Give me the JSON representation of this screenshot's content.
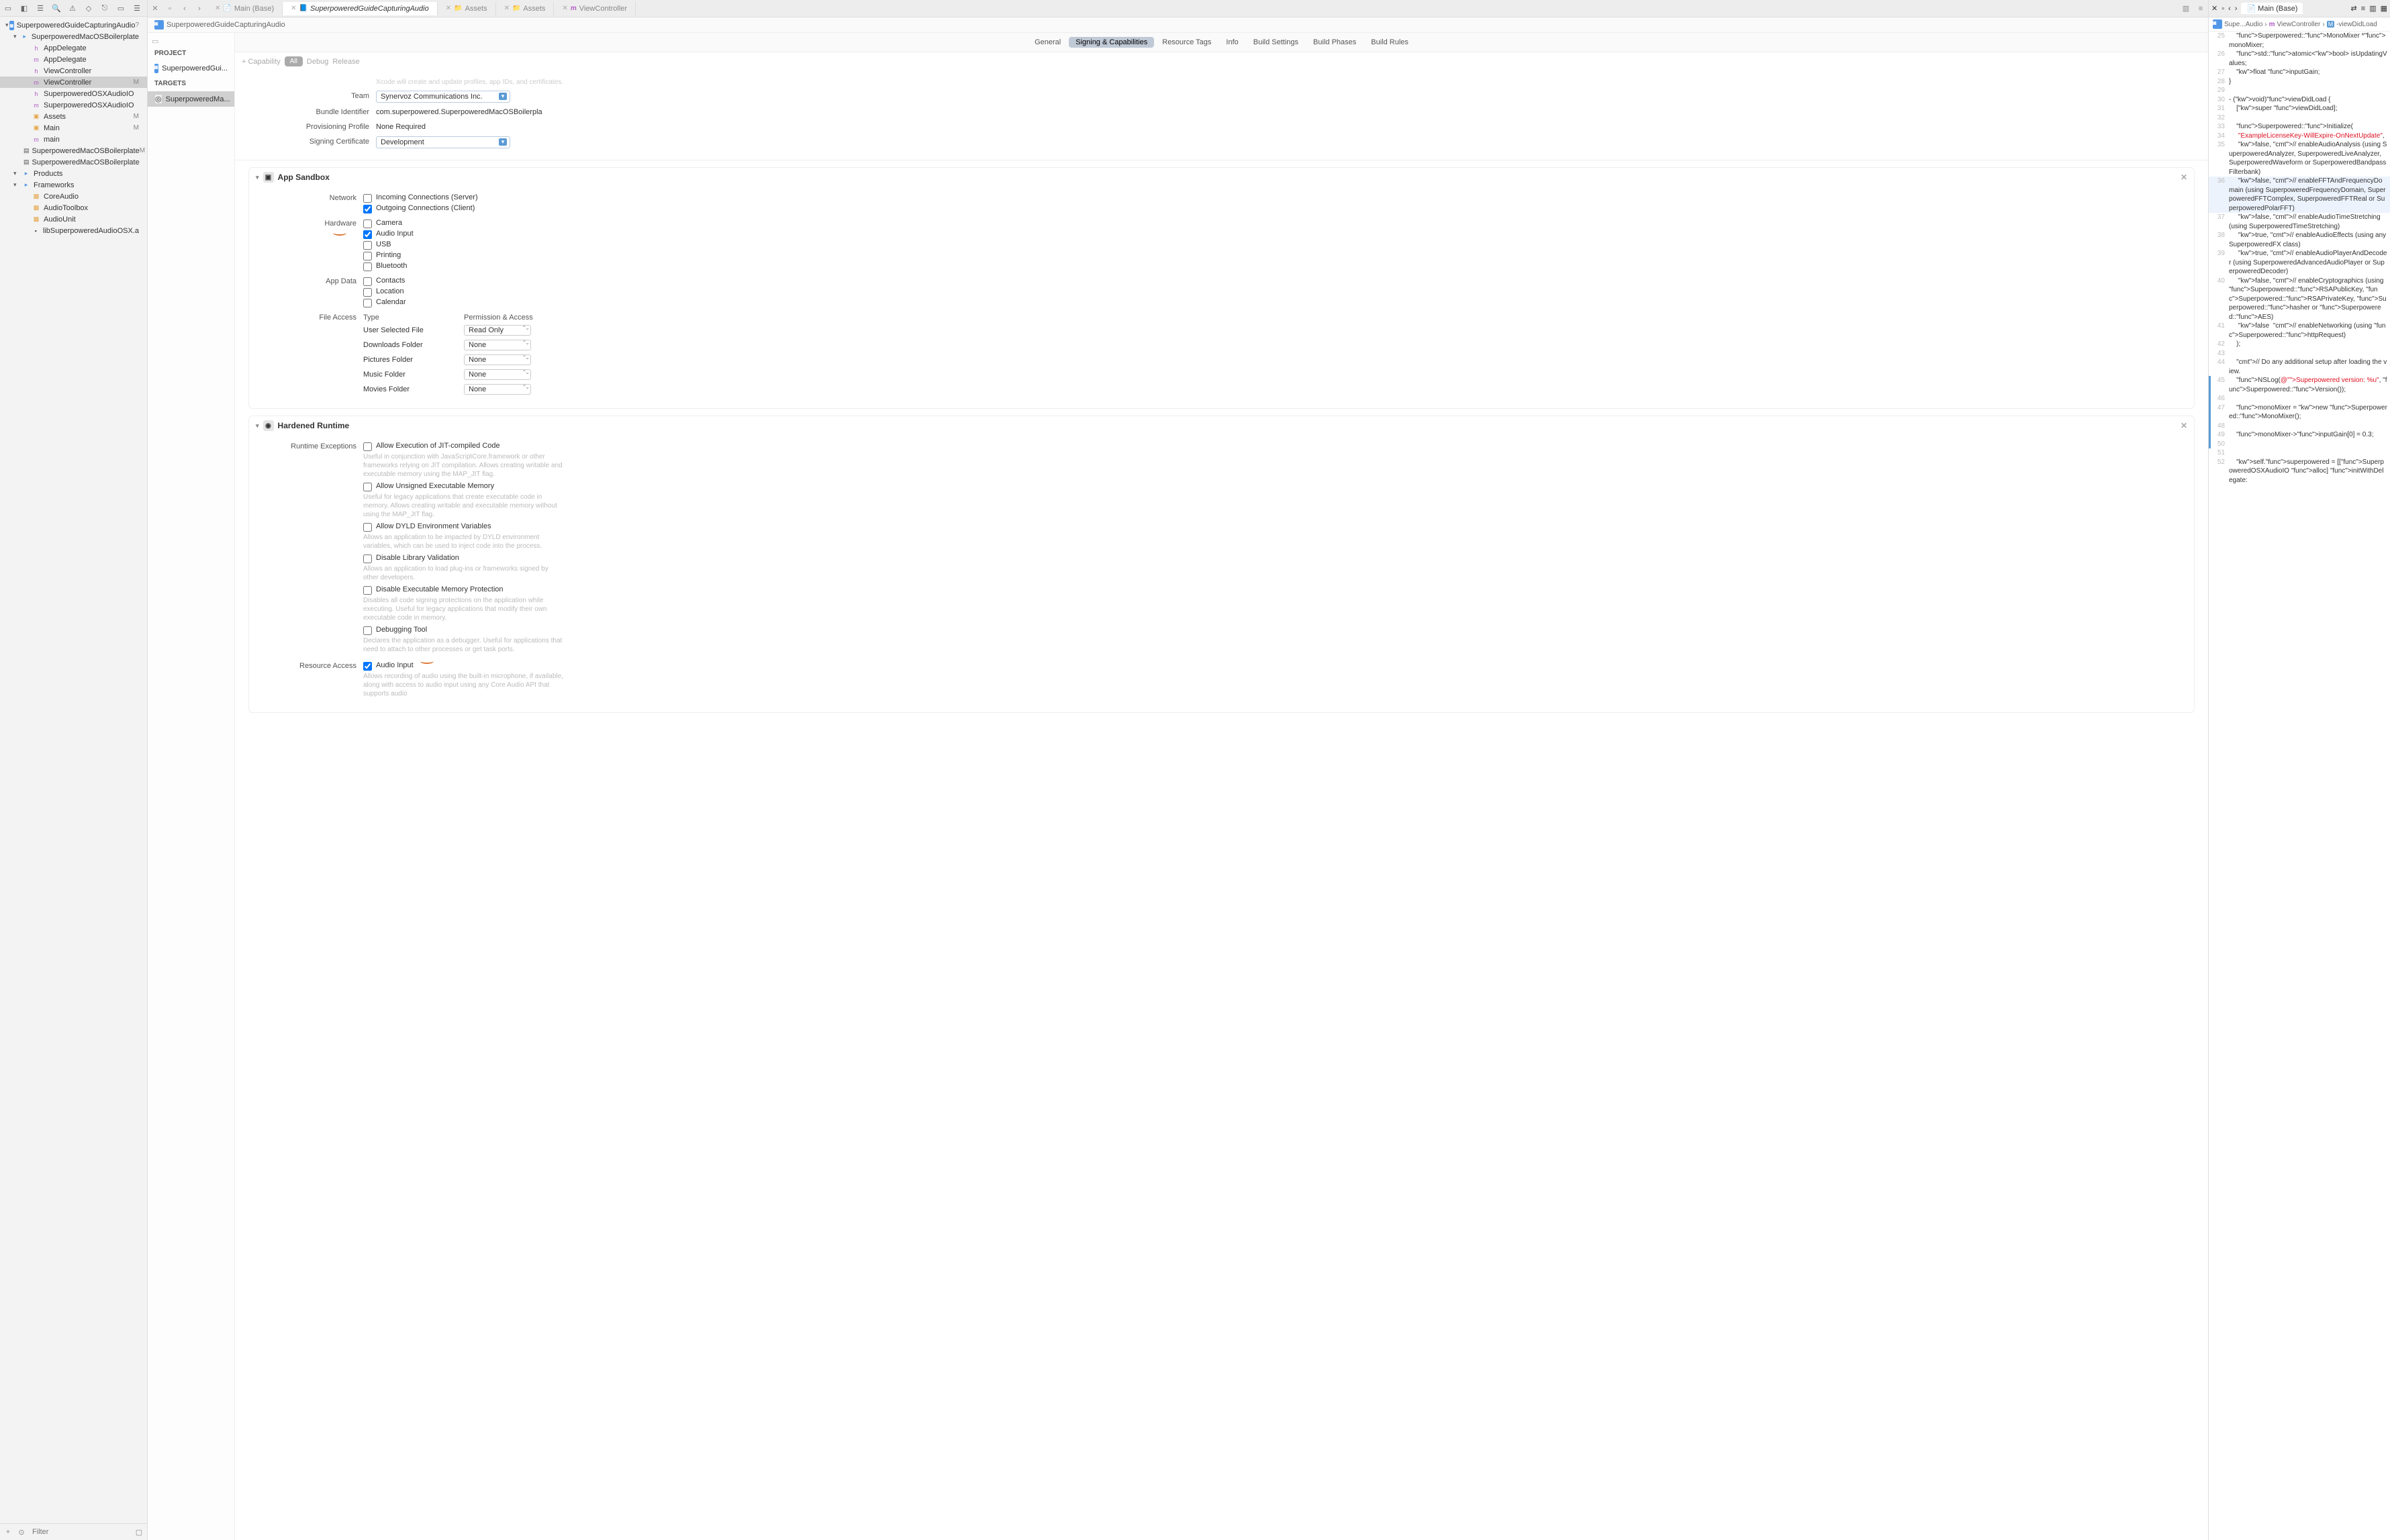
{
  "nav": {
    "root": "SuperpoweredGuideCapturingAudio",
    "rootBadge": "?",
    "items": [
      {
        "label": "SuperpoweredMacOSBoilerplate",
        "icon": "folder",
        "level": 1,
        "badge": ""
      },
      {
        "label": "AppDelegate",
        "icon": "h",
        "level": 2,
        "badge": ""
      },
      {
        "label": "AppDelegate",
        "icon": "m",
        "level": 2,
        "badge": ""
      },
      {
        "label": "ViewController",
        "icon": "h",
        "level": 2,
        "badge": ""
      },
      {
        "label": "ViewController",
        "icon": "m",
        "level": 2,
        "badge": "M",
        "selected": true
      },
      {
        "label": "SuperpoweredOSXAudioIO",
        "icon": "h",
        "level": 2,
        "badge": ""
      },
      {
        "label": "SuperpoweredOSXAudioIO",
        "icon": "m",
        "level": 2,
        "badge": ""
      },
      {
        "label": "Assets",
        "icon": "assets",
        "level": 2,
        "badge": "M"
      },
      {
        "label": "Main",
        "icon": "assets",
        "level": 2,
        "badge": "M"
      },
      {
        "label": "main",
        "icon": "m",
        "level": 2,
        "badge": ""
      },
      {
        "label": "SuperpoweredMacOSBoilerplate",
        "icon": "plist",
        "level": 2,
        "badge": "M"
      },
      {
        "label": "SuperpoweredMacOSBoilerplate",
        "icon": "plist",
        "level": 2,
        "badge": ""
      },
      {
        "label": "Products",
        "icon": "folder",
        "level": 1,
        "badge": ""
      },
      {
        "label": "CoreAudio",
        "icon": "fw",
        "level": 2,
        "badge": ""
      },
      {
        "label": "AudioToolbox",
        "icon": "fw",
        "level": 2,
        "badge": ""
      },
      {
        "label": "AudioUnit",
        "icon": "fw",
        "level": 2,
        "badge": ""
      },
      {
        "label": "libSuperpoweredAudioOSX.a",
        "icon": "lib",
        "level": 2,
        "badge": ""
      }
    ],
    "frameworksLabel": "Frameworks",
    "filterPlaceholder": "Filter"
  },
  "tabs": [
    {
      "label": "Main (Base)",
      "icon": "📄",
      "active": false
    },
    {
      "label": "SuperpoweredGuideCapturingAudio",
      "icon": "📘",
      "active": true,
      "italic": true
    },
    {
      "label": "Assets",
      "icon": "📁",
      "active": false
    },
    {
      "label": "Assets",
      "icon": "📁",
      "active": false
    },
    {
      "label": "ViewController",
      "icon": "m",
      "active": false
    }
  ],
  "breadcrumb": "SuperpoweredGuideCapturingAudio",
  "projectList": {
    "projectLabel": "PROJECT",
    "projectName": "SuperpoweredGui...",
    "targetsLabel": "TARGETS",
    "targetName": "SuperpoweredMa..."
  },
  "settingsTabs": [
    "General",
    "Signing & Capabilities",
    "Resource Tags",
    "Info",
    "Build Settings",
    "Build Phases",
    "Build Rules"
  ],
  "activeSettingsTab": "Signing & Capabilities",
  "capControls": {
    "capability": "+ Capability",
    "all": "All",
    "debug": "Debug",
    "release": "Release"
  },
  "signing": {
    "hint": "Xcode will create and update profiles, app IDs, and certificates.",
    "teamLabel": "Team",
    "teamValue": "Synervoz Communications Inc.",
    "bundleLabel": "Bundle Identifier",
    "bundleValue": "com.superpowered.SuperpoweredMacOSBoilerpla",
    "profileLabel": "Provisioning Profile",
    "profileValue": "None Required",
    "certLabel": "Signing Certificate",
    "certValue": "Development"
  },
  "sandbox": {
    "title": "App Sandbox",
    "networkLabel": "Network",
    "incoming": "Incoming Connections (Server)",
    "outgoing": "Outgoing Connections (Client)",
    "hardwareLabel": "Hardware",
    "camera": "Camera",
    "audioInput": "Audio Input",
    "usb": "USB",
    "printing": "Printing",
    "bluetooth": "Bluetooth",
    "appDataLabel": "App Data",
    "contacts": "Contacts",
    "location": "Location",
    "calendar": "Calendar",
    "fileAccessLabel": "File Access",
    "typeHdr": "Type",
    "permHdr": "Permission & Access",
    "rows": [
      {
        "type": "User Selected File",
        "perm": "Read Only"
      },
      {
        "type": "Downloads Folder",
        "perm": "None"
      },
      {
        "type": "Pictures Folder",
        "perm": "None"
      },
      {
        "type": "Music Folder",
        "perm": "None"
      },
      {
        "type": "Movies Folder",
        "perm": "None"
      }
    ]
  },
  "hardened": {
    "title": "Hardened Runtime",
    "runtimeLabel": "Runtime Exceptions",
    "jit": "Allow Execution of JIT-compiled Code",
    "jitDesc": "Useful in conjunction with JavaScriptCore.framework or other frameworks relying on JIT compilation. Allows creating writable and executable memory using the MAP_JIT flag.",
    "unsigned": "Allow Unsigned Executable Memory",
    "unsignedDesc": "Useful for legacy applications that create executable code in memory. Allows creating writable and executable memory without using the MAP_JIT flag.",
    "dyld": "Allow DYLD Environment Variables",
    "dyldDesc": "Allows an application to be impacted by DYLD environment variables, which can be used to inject code into the process.",
    "library": "Disable Library Validation",
    "libraryDesc": "Allows an application to load plug-ins or frameworks signed by other developers.",
    "memprot": "Disable Executable Memory Protection",
    "memprotDesc": "Disables all code signing protections on the application while executing. Useful for legacy applications that modify their own executable code in memory.",
    "debug": "Debugging Tool",
    "debugDesc": "Declares the application as a debugger. Useful for applications that need to attach to other processes or get task ports.",
    "resourceLabel": "Resource Access",
    "audioInput": "Audio Input",
    "audioInputDesc": "Allows recording of audio using the built-in microphone, if available, along with access to audio input using any Core Audio API that supports audio"
  },
  "rightPanel": {
    "tabLabel": "Main (Base)",
    "breadcrumb": [
      "Supe...Audio",
      "ViewController",
      "-viewDidLoad"
    ],
    "code": [
      {
        "n": 25,
        "txt": "    Superpowered::MonoMixer *monoMixer;"
      },
      {
        "n": 26,
        "txt": "    std::atomic<bool> isUpdatingValues;"
      },
      {
        "n": 27,
        "txt": "    float inputGain;"
      },
      {
        "n": 28,
        "txt": "}"
      },
      {
        "n": 29,
        "txt": ""
      },
      {
        "n": 30,
        "txt": "- (void)viewDidLoad {"
      },
      {
        "n": 31,
        "txt": "    [super viewDidLoad];"
      },
      {
        "n": 32,
        "txt": ""
      },
      {
        "n": 33,
        "txt": "    Superpowered::Initialize("
      },
      {
        "n": 34,
        "txt": "     \"ExampleLicenseKey-WillExpire-OnNextUpdate\","
      },
      {
        "n": 35,
        "txt": "     false, // enableAudioAnalysis (using SuperpoweredAnalyzer, SuperpoweredLiveAnalyzer, SuperpoweredWaveform or SuperpoweredBandpassFilterbank)"
      },
      {
        "n": 36,
        "txt": "     false, // enableFFTAndFrequencyDomain (using SuperpoweredFrequencyDomain, SuperpoweredFFTComplex, SuperpoweredFFTReal or SuperpoweredPolarFFT)",
        "hl": true
      },
      {
        "n": 37,
        "txt": "     false, // enableAudioTimeStretching (using SuperpoweredTimeStretching)"
      },
      {
        "n": 38,
        "txt": "     true, // enableAudioEffects (using any SuperpoweredFX class)"
      },
      {
        "n": 39,
        "txt": "     true, // enableAudioPlayerAndDecoder (using SuperpoweredAdvancedAudioPlayer or SuperpoweredDecoder)"
      },
      {
        "n": 40,
        "txt": "     false, // enableCryptographics (using Superpowered::RSAPublicKey, Superpowered::RSAPrivateKey, Superpowered::hasher or Superpowered::AES)"
      },
      {
        "n": 41,
        "txt": "     false  // enableNetworking (using Superpowered::httpRequest)"
      },
      {
        "n": 42,
        "txt": "    );"
      },
      {
        "n": 43,
        "txt": ""
      },
      {
        "n": 44,
        "txt": "    // Do any additional setup after loading the view."
      },
      {
        "n": 45,
        "txt": "    NSLog(@\"Superpowered version: %u\", Superpowered::Version());",
        "mark": true
      },
      {
        "n": 46,
        "txt": "",
        "mark": true
      },
      {
        "n": 47,
        "txt": "    monoMixer = new Superpowered::MonoMixer();",
        "mark": true
      },
      {
        "n": 48,
        "txt": "",
        "mark": true
      },
      {
        "n": 49,
        "txt": "    monoMixer->inputGain[0] = 0.3;",
        "mark": true
      },
      {
        "n": 50,
        "txt": "",
        "mark": true
      },
      {
        "n": 51,
        "txt": ""
      },
      {
        "n": 52,
        "txt": "    self.superpowered = [[SuperpoweredOSXAudioIO alloc] initWithDelegate:"
      }
    ]
  }
}
